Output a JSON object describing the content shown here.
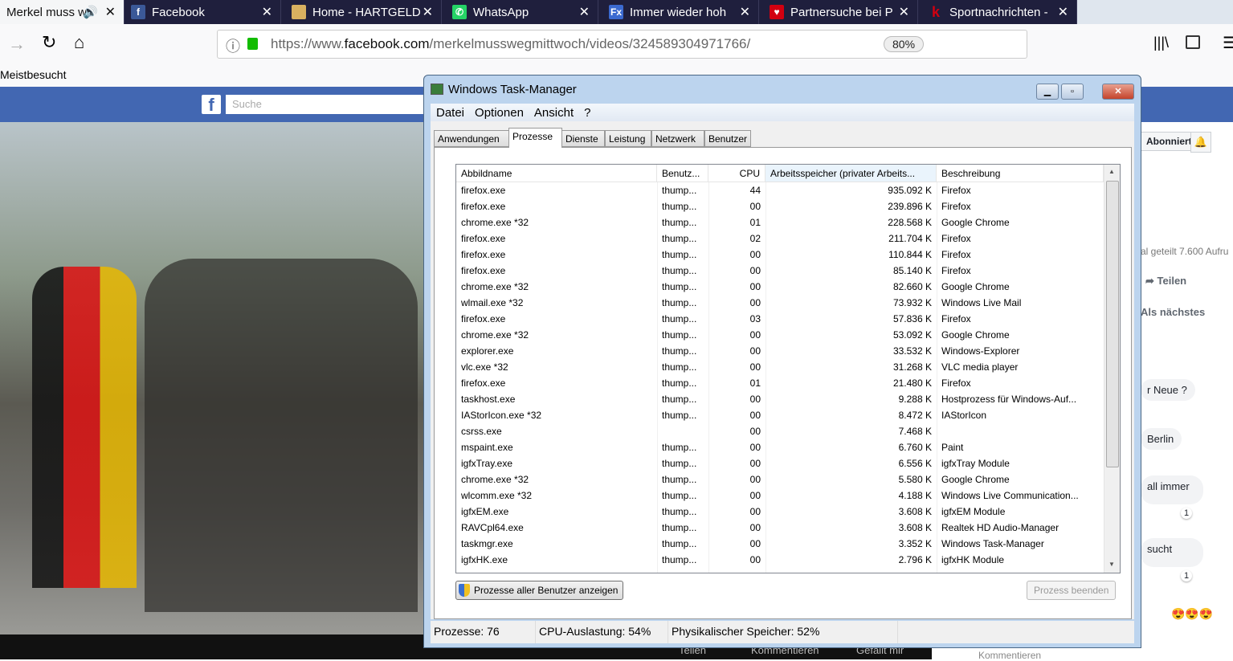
{
  "browser": {
    "tabs": [
      {
        "title": "Merkel muss w",
        "icon": "speaker-icon",
        "active": true
      },
      {
        "title": "Facebook",
        "icon": "facebook-icon"
      },
      {
        "title": "Home - HARTGELD",
        "icon": "hartgeld-icon"
      },
      {
        "title": "WhatsApp",
        "icon": "whatsapp-icon"
      },
      {
        "title": "Immer wieder hoh",
        "icon": "fx-icon"
      },
      {
        "title": "Partnersuche bei P",
        "icon": "heart-icon"
      },
      {
        "title": "Sportnachrichten -",
        "icon": "kicker-icon"
      }
    ],
    "url_prefix": "https://www.",
    "url_domain": "facebook.com",
    "url_path": "/merkelmusswegmittwoch/videos/324589304971766/",
    "zoom": "80%",
    "bookmark": "Meistbesucht"
  },
  "facebook": {
    "search_placeholder": "Suche",
    "subscribed": "Abonniert",
    "stats": "al geteilt  7.600 Aufru",
    "share": "Teilen",
    "up_next": "Als nächstes",
    "comments": [
      "r Neue ?",
      "Berlin",
      "all immer",
      "sucht"
    ],
    "reaction_counts": [
      "1",
      "1"
    ],
    "bottom_actions": [
      "Teilen",
      "Kommentieren",
      "Gefällt mir"
    ],
    "comment_placeholder": "Kommentieren"
  },
  "taskmanager": {
    "title": "Windows Task-Manager",
    "menu": [
      "Datei",
      "Optionen",
      "Ansicht",
      "?"
    ],
    "tabs": [
      "Anwendungen",
      "Prozesse",
      "Dienste",
      "Leistung",
      "Netzwerk",
      "Benutzer"
    ],
    "active_tab": "Prozesse",
    "columns": [
      "Abbildname",
      "Benutz...",
      "CPU",
      "Arbeitsspeicher (privater Arbeits...",
      "Beschreibung"
    ],
    "rows": [
      [
        "firefox.exe",
        "thump...",
        "44",
        "935.092 K",
        "Firefox"
      ],
      [
        "firefox.exe",
        "thump...",
        "00",
        "239.896 K",
        "Firefox"
      ],
      [
        "chrome.exe *32",
        "thump...",
        "01",
        "228.568 K",
        "Google Chrome"
      ],
      [
        "firefox.exe",
        "thump...",
        "02",
        "211.704 K",
        "Firefox"
      ],
      [
        "firefox.exe",
        "thump...",
        "00",
        "110.844 K",
        "Firefox"
      ],
      [
        "firefox.exe",
        "thump...",
        "00",
        "85.140 K",
        "Firefox"
      ],
      [
        "chrome.exe *32",
        "thump...",
        "00",
        "82.660 K",
        "Google Chrome"
      ],
      [
        "wlmail.exe *32",
        "thump...",
        "00",
        "73.932 K",
        "Windows Live Mail"
      ],
      [
        "firefox.exe",
        "thump...",
        "03",
        "57.836 K",
        "Firefox"
      ],
      [
        "chrome.exe *32",
        "thump...",
        "00",
        "53.092 K",
        "Google Chrome"
      ],
      [
        "explorer.exe",
        "thump...",
        "00",
        "33.532 K",
        "Windows-Explorer"
      ],
      [
        "vlc.exe *32",
        "thump...",
        "00",
        "31.268 K",
        "VLC media player"
      ],
      [
        "firefox.exe",
        "thump...",
        "01",
        "21.480 K",
        "Firefox"
      ],
      [
        "taskhost.exe",
        "thump...",
        "00",
        "9.288 K",
        "Hostprozess für Windows-Auf..."
      ],
      [
        "IAStorIcon.exe *32",
        "thump...",
        "00",
        "8.472 K",
        "IAStorIcon"
      ],
      [
        "csrss.exe",
        "",
        "00",
        "7.468 K",
        ""
      ],
      [
        "mspaint.exe",
        "thump...",
        "00",
        "6.760 K",
        "Paint"
      ],
      [
        "igfxTray.exe",
        "thump...",
        "00",
        "6.556 K",
        "igfxTray Module"
      ],
      [
        "chrome.exe *32",
        "thump...",
        "00",
        "5.580 K",
        "Google Chrome"
      ],
      [
        "wlcomm.exe *32",
        "thump...",
        "00",
        "4.188 K",
        "Windows Live Communication..."
      ],
      [
        "igfxEM.exe",
        "thump...",
        "00",
        "3.608 K",
        "igfxEM Module"
      ],
      [
        "RAVCpl64.exe",
        "thump...",
        "00",
        "3.608 K",
        "Realtek HD Audio-Manager"
      ],
      [
        "taskmgr.exe",
        "thump...",
        "00",
        "3.352 K",
        "Windows Task-Manager"
      ],
      [
        "igfxHK.exe",
        "thump...",
        "00",
        "2.796 K",
        "igfxHK Module"
      ]
    ],
    "show_all_button": "Prozesse aller Benutzer anzeigen",
    "end_process_button": "Prozess beenden",
    "status": {
      "processes": "Prozesse: 76",
      "cpu": "CPU-Auslastung: 54%",
      "memory": "Physikalischer Speicher: 52%"
    }
  }
}
